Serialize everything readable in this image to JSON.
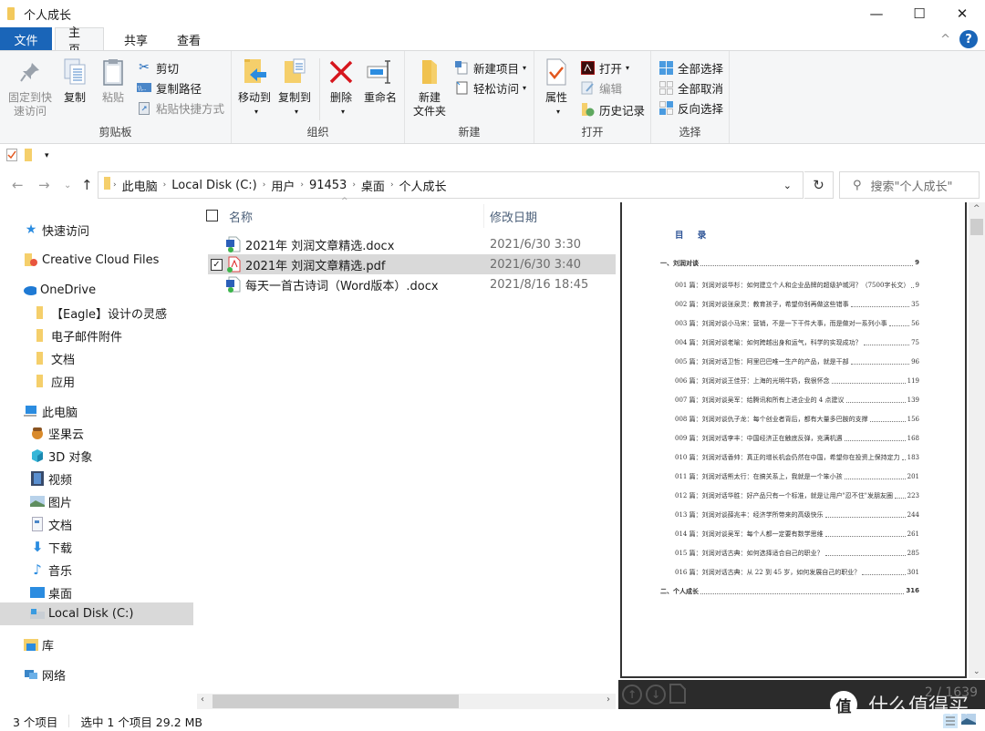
{
  "window": {
    "title": "个人成长",
    "minimize": "—",
    "maximize": "☐",
    "close": "✕"
  },
  "ribbon_tabs": {
    "file": "文件",
    "home": "主页",
    "share": "共享",
    "view": "查看",
    "collapse": "^",
    "help": "?"
  },
  "ribbon": {
    "clipboard": {
      "label": "剪贴板",
      "pin": "固定到快速访问",
      "pin_line1": "固定到快",
      "pin_line2": "速访问",
      "copy": "复制",
      "paste": "粘贴",
      "cut": "剪切",
      "copy_path": "复制路径",
      "paste_shortcut": "粘贴快捷方式"
    },
    "organize": {
      "label": "组织",
      "move_to": "移动到",
      "copy_to": "复制到",
      "delete": "删除",
      "rename": "重命名"
    },
    "new": {
      "label": "新建",
      "new_folder_line1": "新建",
      "new_folder_line2": "文件夹",
      "new_item": "新建项目",
      "easy_access": "轻松访问"
    },
    "open": {
      "label": "打开",
      "properties": "属性",
      "open": "打开",
      "edit": "编辑",
      "history": "历史记录"
    },
    "select": {
      "label": "选择",
      "select_all": "全部选择",
      "select_none": "全部取消",
      "invert": "反向选择"
    }
  },
  "address": {
    "crumbs": [
      "此电脑",
      "Local Disk (C:)",
      "用户",
      "91453",
      "桌面",
      "个人成长"
    ],
    "search_placeholder": "搜索\"个人成长\""
  },
  "nav": {
    "quick_access": "快速访问",
    "creative_cloud": "Creative Cloud Files",
    "onedrive": "OneDrive",
    "onedrive_items": [
      "【Eagle】设计の灵感",
      "电子邮件附件",
      "文档",
      "应用"
    ],
    "this_pc": "此电脑",
    "pc_items": [
      "坚果云",
      "3D 对象",
      "视频",
      "图片",
      "文档",
      "下载",
      "音乐",
      "桌面",
      "Local Disk (C:)"
    ],
    "libraries": "库",
    "network": "网络"
  },
  "files": {
    "col_name": "名称",
    "col_date": "修改日期",
    "rows": [
      {
        "name": "2021年 刘润文章精选.docx",
        "date": "2021/6/30 3:30",
        "type": "docx",
        "selected": false
      },
      {
        "name": "2021年 刘润文章精选.pdf",
        "date": "2021/6/30 3:40",
        "type": "pdf",
        "selected": true
      },
      {
        "name": "每天一首古诗词（Word版本）.docx",
        "date": "2021/8/16 18:45",
        "type": "docx",
        "selected": false
      }
    ]
  },
  "preview": {
    "toc_title": "目 录",
    "section1": {
      "title": "一、刘润对谈",
      "page": "9"
    },
    "entries": [
      {
        "text": "001 篇：刘润对谈华杉：如何建立个人和企业品牌的超级护城河？（7500字长文）",
        "page": "9"
      },
      {
        "text": "002 篇：刘润对谈张泉灵：教育孩子，希望你别再做这些错事",
        "page": "35"
      },
      {
        "text": "003 篇：刘润对谈小马宋：营销，不是一下干件大事，而是做对一系列小事",
        "page": "56"
      },
      {
        "text": "004 篇：刘润对谈老喻：如何跨越出身和运气，科学的实现成功？",
        "page": "75"
      },
      {
        "text": "005 篇：刘润对话卫哲：阿里巴巴唯一生产的产品，就是干部",
        "page": "96"
      },
      {
        "text": "006 篇：刘润对谈王佳芬：上海的光明牛奶，我很怀念",
        "page": "119"
      },
      {
        "text": "007 篇：刘润对谈吴军：给腾讯和所有上进企业的 4 点建议",
        "page": "139"
      },
      {
        "text": "008 篇：刘润对谈仇子龙：每个创业者背后，都有大量多巴胺的支撑",
        "page": "156"
      },
      {
        "text": "009 篇：刘润对话李丰：中国经济正在触底反弹，充满机遇",
        "page": "168"
      },
      {
        "text": "010 篇：刘润对话香帅：真正的增长机会仍然在中国，希望你在投资上保持定力",
        "page": "183"
      },
      {
        "text": "011 篇：刘润对话熊太行：在搞关系上，我就是一个笨小孩",
        "page": "201"
      },
      {
        "text": "012 篇：刘润对话华胜：好产品只有一个标准，就是让用户\"忍不住\"发朋友圈",
        "page": "223"
      },
      {
        "text": "013 篇：刘润对谈薛兆丰：经济学所带来的高级快乐",
        "page": "244"
      },
      {
        "text": "014 篇：刘润对谈吴军：每个人都一定要有数学思维",
        "page": "261"
      },
      {
        "text": "015 篇：刘润对话古典：如何选择适合自己的职业？",
        "page": "285"
      },
      {
        "text": "016 篇：刘润对话古典：从 22 到 45 岁，如何发展自己的职业？",
        "page": "301"
      }
    ],
    "section2": {
      "title": "二、个人成长",
      "page": "316"
    },
    "page_indicator": "2 / 1639"
  },
  "status": {
    "item_count": "3 个项目",
    "selection": "选中 1 个项目  29.2 MB"
  },
  "watermark": {
    "logo": "值",
    "text": "什么值得买"
  }
}
